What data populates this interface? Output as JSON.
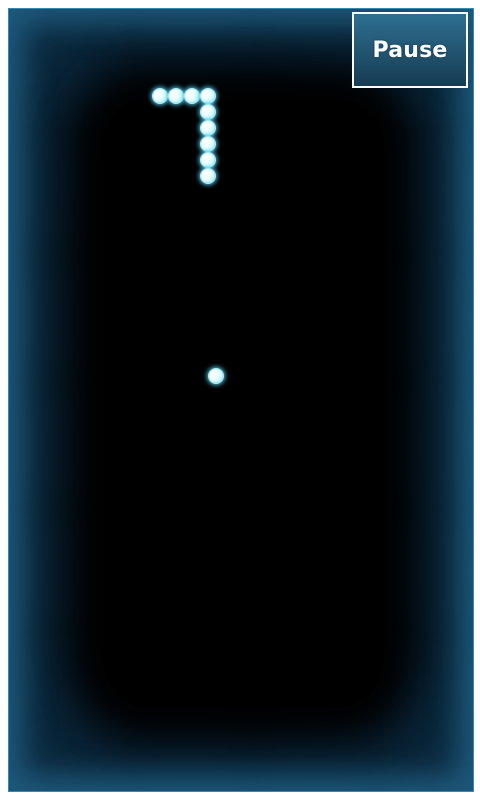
{
  "controls": {
    "pause_label": "Pause"
  },
  "game": {
    "snake_segment_count": 9,
    "food_count": 1,
    "colors": {
      "background": "#000000",
      "border_glow": "#2f8fbe",
      "snake_and_food": "#dfffff",
      "button_background": "#1f5574",
      "button_border": "#ffffff",
      "button_text": "#ffffff"
    }
  }
}
